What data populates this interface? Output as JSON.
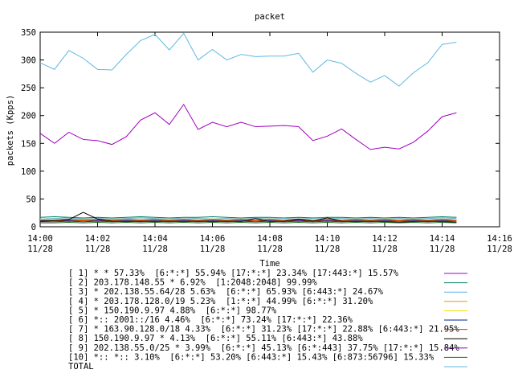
{
  "chart_data": {
    "type": "line",
    "title": "packet",
    "xlabel": "Time",
    "ylabel": "packets (Kpps)",
    "ylim": [
      0,
      350
    ],
    "yticks": [
      0,
      50,
      100,
      150,
      200,
      250,
      300,
      350
    ],
    "xlim": [
      "14:00",
      "14:16"
    ],
    "xticks": [
      {
        "time": "14:00",
        "date": "11/28"
      },
      {
        "time": "14:02",
        "date": "11/28"
      },
      {
        "time": "14:04",
        "date": "11/28"
      },
      {
        "time": "14:06",
        "date": "11/28"
      },
      {
        "time": "14:08",
        "date": "11/28"
      },
      {
        "time": "14:10",
        "date": "11/28"
      },
      {
        "time": "14:12",
        "date": "11/28"
      },
      {
        "time": "14:14",
        "date": "11/28"
      },
      {
        "time": "14:16",
        "date": "11/28"
      }
    ],
    "x": [
      "14:00:00",
      "14:00:30",
      "14:01:00",
      "14:01:30",
      "14:02:00",
      "14:02:30",
      "14:03:00",
      "14:03:30",
      "14:04:00",
      "14:04:30",
      "14:05:00",
      "14:05:30",
      "14:06:00",
      "14:06:30",
      "14:07:00",
      "14:07:30",
      "14:08:00",
      "14:08:30",
      "14:09:00",
      "14:09:30",
      "14:10:00",
      "14:10:30",
      "14:11:00",
      "14:11:30",
      "14:12:00",
      "14:12:30",
      "14:13:00",
      "14:13:30",
      "14:14:00",
      "14:14:30"
    ],
    "grid": false,
    "legend_placement": "bottom",
    "series": [
      {
        "label": "[ 1] * * 57.33%  [6:*:*] 55.94% [17:*:*] 23.34% [17:443:*] 15.57%",
        "color": "#a000c0",
        "values": [
          168,
          150,
          170,
          157,
          155,
          148,
          162,
          192,
          205,
          184,
          220,
          175,
          188,
          180,
          188,
          180,
          181,
          182,
          180,
          155,
          163,
          176,
          157,
          139,
          143,
          140,
          152,
          172,
          198,
          205
        ]
      },
      {
        "label": "[ 2] 203.178.148.55 * 6.92%  [1:2048:2048] 99.99%",
        "color": "#00806a",
        "values": [
          17,
          18,
          17,
          16,
          17,
          16,
          17,
          18,
          17,
          16,
          17,
          17,
          18,
          17,
          16,
          17,
          17,
          16,
          17,
          16,
          17,
          17,
          16,
          17,
          16,
          17,
          16,
          17,
          18,
          17
        ]
      },
      {
        "label": "[ 3] * 202.138.55.64/28 5.63%  [6:*:*] 65.93% [6:443:*] 24.67%",
        "color": "#58b4e8",
        "values": [
          14,
          15,
          16,
          14,
          15,
          14,
          15,
          16,
          15,
          14,
          16,
          15,
          14,
          15,
          14,
          15,
          16,
          15,
          14,
          15,
          16,
          15,
          14,
          15,
          14,
          15,
          14,
          15,
          16,
          15
        ]
      },
      {
        "label": "[ 4] * 203.178.128.0/19 5.23%  [1:*:*] 44.99% [6:*:*] 31.20%",
        "color": "#e0a000",
        "values": [
          13,
          13,
          14,
          13,
          14,
          13,
          14,
          13,
          14,
          13,
          14,
          13,
          14,
          13,
          14,
          13,
          14,
          13,
          14,
          13,
          14,
          13,
          14,
          13,
          14,
          13,
          14,
          13,
          14,
          13
        ]
      },
      {
        "label": "[ 5] * 150.190.9.97 4.88%  [6:*:*] 98.77%",
        "color": "#f0e000",
        "values": [
          12,
          12,
          13,
          12,
          13,
          12,
          13,
          12,
          12,
          13,
          12,
          13,
          12,
          13,
          12,
          13,
          12,
          13,
          12,
          13,
          12,
          13,
          12,
          13,
          12,
          13,
          12,
          13,
          12,
          13
        ]
      },
      {
        "label": "[ 6] *:: 2001::/16 4.46%  [6:*:*] 73.24% [17:*:*] 22.36%",
        "color": "#002090",
        "values": [
          11,
          11,
          12,
          11,
          12,
          11,
          12,
          11,
          12,
          11,
          12,
          11,
          12,
          11,
          12,
          11,
          12,
          11,
          12,
          11,
          12,
          11,
          12,
          11,
          12,
          11,
          12,
          11,
          12,
          11
        ]
      },
      {
        "label": "[ 7] * 163.90.128.0/18 4.33%  [6:*:*] 31.23% [17:*:*] 22.88% [6:443:*] 21.95%",
        "color": "#e03000",
        "values": [
          10,
          11,
          10,
          11,
          10,
          11,
          10,
          11,
          10,
          11,
          10,
          11,
          10,
          11,
          10,
          11,
          10,
          11,
          10,
          11,
          10,
          11,
          10,
          11,
          10,
          11,
          10,
          11,
          10,
          11
        ]
      },
      {
        "label": "[ 8] 150.190.9.97 * 4.13%  [6:*:*] 55.11% [6:443:*] 43.88%",
        "color": "#000000",
        "values": [
          10,
          11,
          13,
          26,
          14,
          10,
          9,
          10,
          9,
          10,
          9,
          10,
          9,
          10,
          9,
          15,
          9,
          10,
          14,
          10,
          16,
          10,
          9,
          10,
          9,
          8,
          9,
          10,
          9,
          8
        ]
      },
      {
        "label": "[ 9] 202.138.55.0/25 * 3.99%  [6:*:*] 45.13% [6:*:443] 37.75% [17:*:*] 15.84%",
        "color": "#8000c0",
        "values": [
          9,
          9,
          10,
          9,
          10,
          9,
          10,
          9,
          10,
          9,
          10,
          9,
          10,
          9,
          10,
          9,
          10,
          9,
          10,
          9,
          10,
          9,
          10,
          9,
          10,
          9,
          10,
          9,
          10,
          9
        ]
      },
      {
        "label": "[10] *:: *:: 3.10%  [6:*:*] 53.20% [6:443:*] 15.43% [6:873:56796] 15.33%",
        "color": "#207020",
        "values": [
          7,
          7,
          8,
          7,
          8,
          7,
          8,
          7,
          8,
          7,
          8,
          7,
          8,
          7,
          8,
          7,
          8,
          7,
          8,
          7,
          8,
          7,
          8,
          7,
          8,
          7,
          8,
          7,
          8,
          7
        ]
      },
      {
        "label": "TOTAL",
        "color": "#60b8e0",
        "values": [
          295,
          283,
          317,
          303,
          283,
          282,
          310,
          335,
          346,
          318,
          348,
          300,
          319,
          300,
          310,
          306,
          307,
          307,
          312,
          278,
          300,
          294,
          276,
          260,
          272,
          253,
          277,
          295,
          328,
          332
        ]
      }
    ]
  }
}
